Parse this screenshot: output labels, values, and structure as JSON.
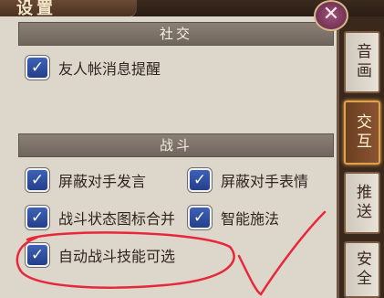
{
  "window": {
    "title": "设置",
    "close_symbol": "✕"
  },
  "sections": {
    "social": {
      "header": "社交",
      "options": [
        {
          "label": "友人帐消息提醒",
          "checked": true
        }
      ]
    },
    "battle": {
      "header": "战斗",
      "options": [
        {
          "label": "屏蔽对手发言",
          "checked": true
        },
        {
          "label": "屏蔽对手表情",
          "checked": true
        },
        {
          "label": "战斗状态图标合并",
          "checked": true
        },
        {
          "label": "智能施法",
          "checked": true
        },
        {
          "label": "自动战斗技能可选",
          "checked": true
        }
      ]
    }
  },
  "check_mark": "✓",
  "side_tabs": [
    {
      "label": "音画",
      "active": false
    },
    {
      "label": "交互",
      "active": true
    },
    {
      "label": "推送",
      "active": false
    },
    {
      "label": "安全",
      "active": false
    }
  ],
  "colors": {
    "annotation": "#e8283a",
    "checkbox": "#2e4fa0",
    "panel": "#ddd7cb"
  }
}
